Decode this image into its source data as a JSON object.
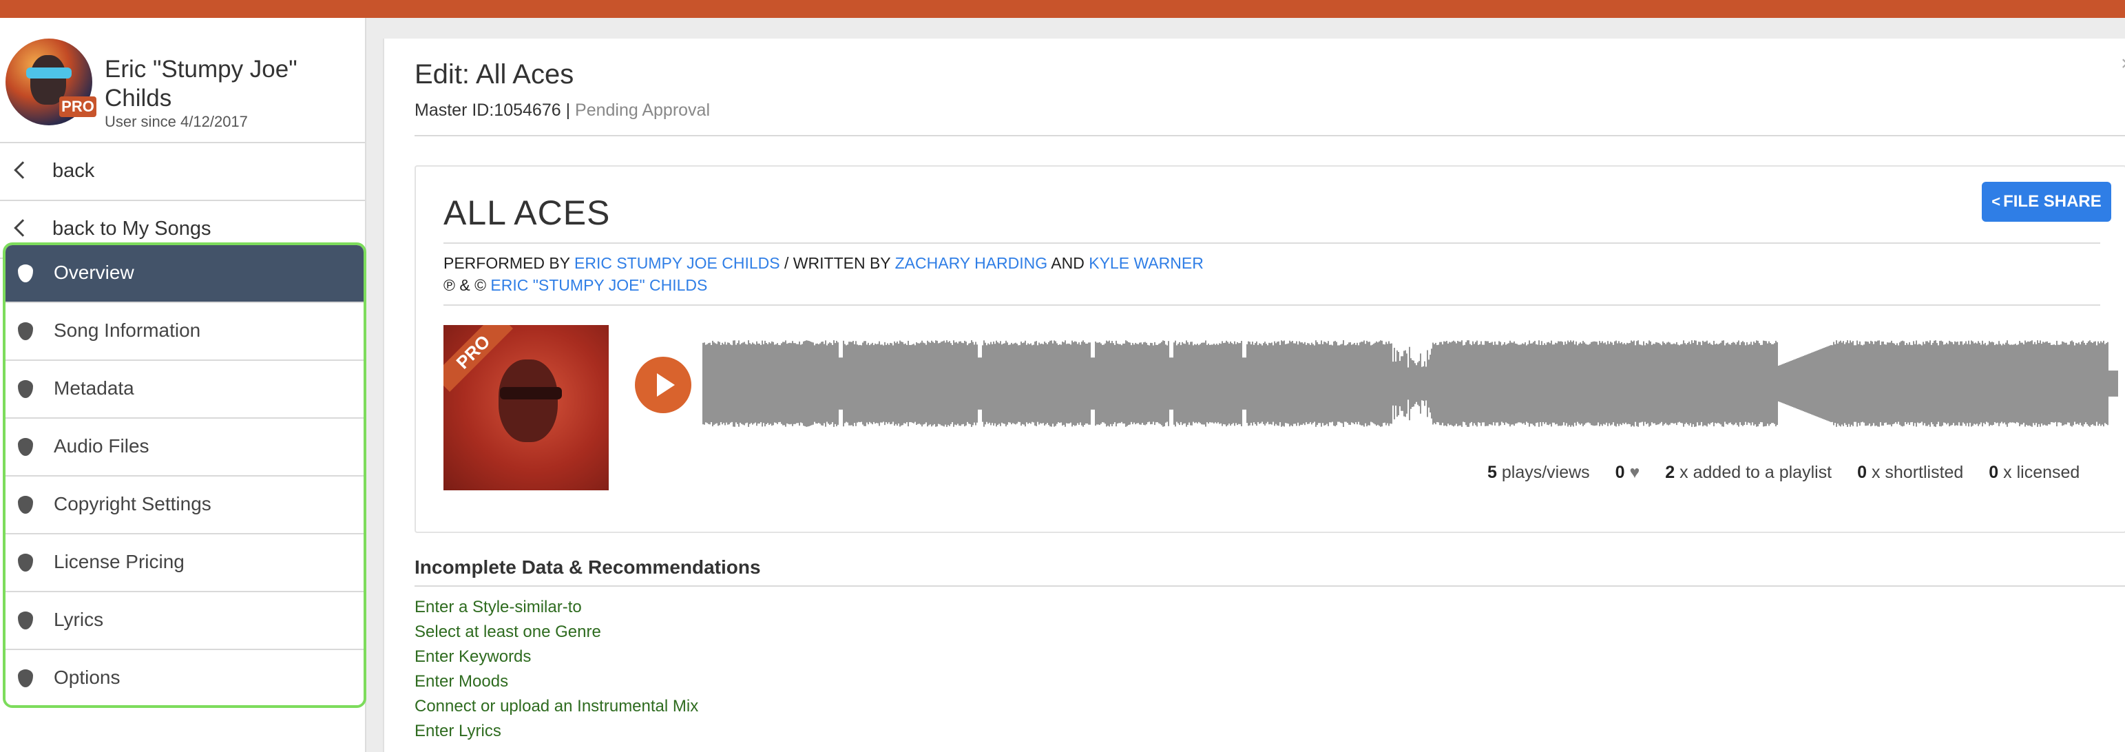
{
  "profile": {
    "name": "Eric \"Stumpy Joe\" Childs",
    "since": "User since 4/12/2017",
    "badge": "PRO"
  },
  "nav": {
    "back": "back",
    "back_songs": "back to My Songs"
  },
  "menu": [
    {
      "label": "Overview",
      "active": true
    },
    {
      "label": "Song Information"
    },
    {
      "label": "Metadata"
    },
    {
      "label": "Audio Files"
    },
    {
      "label": "Copyright Settings"
    },
    {
      "label": "License Pricing"
    },
    {
      "label": "Lyrics"
    },
    {
      "label": "Options"
    }
  ],
  "header": {
    "title": "Edit: All Aces",
    "master_id": "Master ID:1054676",
    "separator": "|",
    "status": "Pending Approval"
  },
  "song": {
    "title": "ALL ACES",
    "share_label": "FILE SHARE",
    "performed_by": "PERFORMED BY",
    "performer": "ERIC STUMPY JOE CHILDS",
    "written_by": "/ WRITTEN BY",
    "writer1": "ZACHARY HARDING",
    "and": "AND",
    "writer2": "KYLE WARNER",
    "copyright_prefix": "℗ & ©",
    "copyright_owner": "ERIC \"STUMPY JOE\" CHILDS",
    "cover_badge": "PRO"
  },
  "stats": {
    "plays_count": "5",
    "plays_label": "plays/views",
    "likes_count": "0",
    "playlist_count": "2",
    "playlist_label": "x added to a playlist",
    "shortlist_count": "0",
    "shortlist_label": "x shortlisted",
    "licensed_count": "0",
    "licensed_label": "x licensed"
  },
  "recommendations": {
    "title": "Incomplete Data & Recommendations",
    "items": [
      "Enter a Style-similar-to",
      "Select at least one Genre",
      "Enter Keywords",
      "Enter Moods",
      "Connect or upload an Instrumental Mix",
      "Enter Lyrics"
    ]
  },
  "colors": {
    "brand": "#c8542b",
    "active_menu": "#435369",
    "link": "#2f7ee6",
    "recommendation": "#2e6b1f",
    "waveform": "#939393",
    "highlight_border": "#7ddc5c"
  }
}
